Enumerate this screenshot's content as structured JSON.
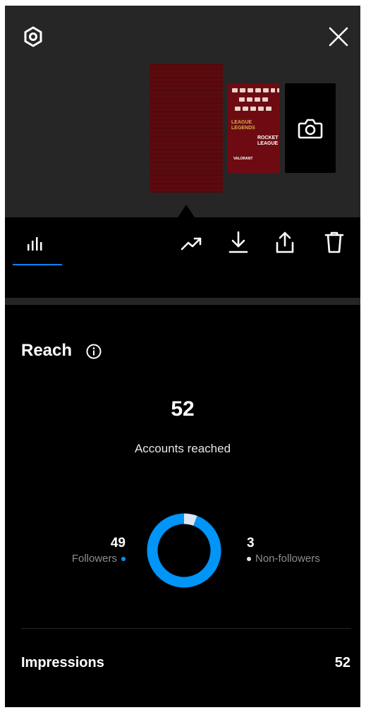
{
  "header": {
    "settings_icon": "gear-icon",
    "close_icon": "close-icon"
  },
  "stories": {
    "selected_color": "#5c0a0e",
    "second_thumb_lines": [
      "LEAGUE",
      "LEGENDS",
      "ROCKET",
      "LEAGUE",
      "VALORANT"
    ]
  },
  "toolbar": {
    "tabs": [
      {
        "icon": "bar-chart-icon",
        "active": true
      }
    ],
    "actions": [
      "trend-icon",
      "download-icon",
      "share-icon",
      "trash-icon"
    ]
  },
  "reach": {
    "title": "Reach",
    "accounts_reached_value": "52",
    "accounts_reached_label": "Accounts reached",
    "followers_value": "49",
    "followers_label": "Followers",
    "non_followers_value": "3",
    "non_followers_label": "Non-followers",
    "followers_color": "#0095f6",
    "non_followers_color": "#dbe7f5"
  },
  "chart_data": {
    "type": "pie",
    "categories": [
      "Followers",
      "Non-followers"
    ],
    "values": [
      49,
      3
    ],
    "colors": [
      "#0095f6",
      "#dbe7f5"
    ]
  },
  "impressions": {
    "label": "Impressions",
    "value": "52"
  }
}
